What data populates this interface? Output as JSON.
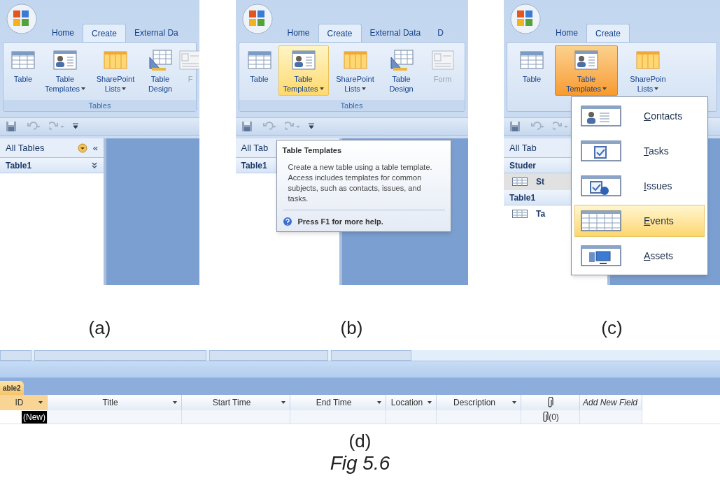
{
  "panels": [
    {
      "caption": "(a)",
      "tabs": [
        {
          "label": "Home",
          "selected": false
        },
        {
          "label": "Create",
          "selected": true
        },
        {
          "label": "External Da",
          "selected": false
        }
      ],
      "ribbon_buttons": [
        {
          "lines": [
            "Table"
          ],
          "highlighted": false,
          "pressed": false,
          "disabled": false
        },
        {
          "lines": [
            "Table",
            "Templates"
          ],
          "highlighted": false,
          "pressed": false,
          "dropdown": true,
          "disabled": false
        },
        {
          "lines": [
            "SharePoint",
            "Lists"
          ],
          "highlighted": false,
          "pressed": false,
          "dropdown": true,
          "disabled": false
        },
        {
          "lines": [
            "Table",
            "Design"
          ],
          "highlighted": false,
          "pressed": false,
          "disabled": false
        },
        {
          "lines": [
            "F"
          ],
          "highlighted": false,
          "pressed": false,
          "disabled": true
        }
      ],
      "group_label": "Tables",
      "nav": {
        "header": "All Tables",
        "collapse": "«",
        "sections": [
          {
            "label": "Table1"
          }
        ]
      }
    },
    {
      "caption": "(b)",
      "tabs": [
        {
          "label": "Home",
          "selected": false
        },
        {
          "label": "Create",
          "selected": true
        },
        {
          "label": "External Data",
          "selected": false
        },
        {
          "label": "D",
          "selected": false
        }
      ],
      "ribbon_buttons": [
        {
          "lines": [
            "Table"
          ],
          "highlighted": false,
          "pressed": false,
          "disabled": false
        },
        {
          "lines": [
            "Table",
            "Templates"
          ],
          "highlighted": true,
          "pressed": false,
          "dropdown": true,
          "disabled": false
        },
        {
          "lines": [
            "SharePoint",
            "Lists"
          ],
          "highlighted": false,
          "pressed": false,
          "dropdown": true,
          "disabled": false
        },
        {
          "lines": [
            "Table",
            "Design"
          ],
          "highlighted": false,
          "pressed": false,
          "disabled": false
        },
        {
          "lines": [
            "Form"
          ],
          "highlighted": false,
          "pressed": false,
          "disabled": true
        }
      ],
      "group_label": "Tables",
      "nav": {
        "header": "All Tab",
        "sections": [
          {
            "label": "Table1"
          }
        ]
      },
      "tooltip": {
        "title": "Table Templates",
        "body": "Create a new table using a table template. Access includes templates for common subjects, such as contacts, issues, and tasks.",
        "help": "Press F1 for more help."
      }
    },
    {
      "caption": "(c)",
      "tabs": [
        {
          "label": "Home",
          "selected": false
        },
        {
          "label": "Create",
          "selected": true
        }
      ],
      "ribbon_buttons": [
        {
          "lines": [
            "Table"
          ],
          "highlighted": false,
          "pressed": false,
          "disabled": false
        },
        {
          "lines": [
            "Table",
            "Templates"
          ],
          "pressed": true,
          "dropdown": true,
          "disabled": false
        },
        {
          "lines": [
            "SharePoin",
            "Lists"
          ],
          "highlighted": false,
          "pressed": false,
          "dropdown": true,
          "disabled": false
        }
      ],
      "nav": {
        "header": "All Tab",
        "sections": [
          {
            "label": "Studer",
            "items": [
              {
                "label": "St",
                "selected": true
              }
            ]
          },
          {
            "label": "Table1",
            "items": [
              {
                "label": "Ta",
                "selected": false
              }
            ]
          }
        ]
      },
      "menu": [
        {
          "label": "Contacts",
          "selected": false
        },
        {
          "label": "Tasks",
          "selected": false
        },
        {
          "label": "Issues",
          "selected": false
        },
        {
          "label": "Events",
          "selected": true
        },
        {
          "label": "Assets",
          "selected": false
        }
      ]
    }
  ],
  "datasheet": {
    "caption": "(d)",
    "tab": "able2",
    "columns": [
      {
        "label": "ID",
        "dropdown": true
      },
      {
        "label": "Title",
        "dropdown": true
      },
      {
        "label": "Start Time",
        "dropdown": true
      },
      {
        "label": "End Time",
        "dropdown": true
      },
      {
        "label": "Location",
        "dropdown": true
      },
      {
        "label": "Description",
        "dropdown": true
      },
      {
        "kind": "attachment"
      },
      {
        "label": "Add New Field",
        "kind": "new"
      }
    ],
    "new_record": "(New)",
    "attachment_count": "(0)"
  },
  "figure_caption": "Fig 5.6"
}
